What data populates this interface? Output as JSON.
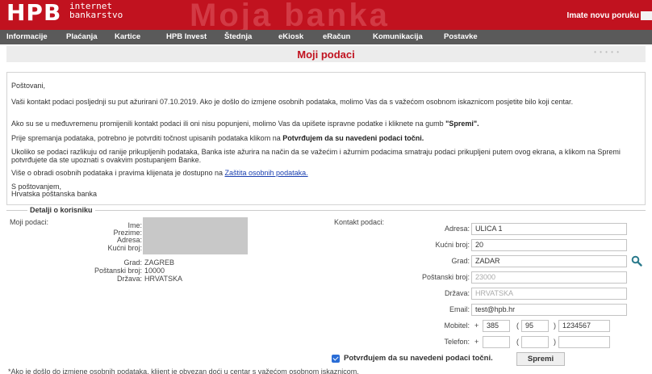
{
  "header": {
    "logo": "HPB",
    "logo_sub_1": "internet",
    "logo_sub_2": "bankarstvo",
    "watermark": "Moja banka",
    "new_message": "Imate novu poruku"
  },
  "nav": {
    "items": [
      "Informacije",
      "Plaćanja",
      "Kartice",
      "HPB Invest",
      "Štednja",
      "eKiosk",
      "eRačun",
      "Komunikacija",
      "Postavke"
    ]
  },
  "page": {
    "title": "Moji podaci",
    "dots": "• • • • •"
  },
  "intro": {
    "greeting": "Poštovani,",
    "p1": "Vaši kontakt podaci posljednji su put ažurirani 07.10.2019. Ako je došlo do izmjene osobnih podataka, molimo Vas da s važećom osobnom iskaznicom posjetite bilo koji centar.",
    "p2_before": "Ako su se u međuvremenu promijenili kontakt podaci ili oni nisu popunjeni, molimo Vas da upišete ispravne podatke i kliknete na gumb ",
    "p2_bold": "\"Spremi\".",
    "p3_before": "Prije spremanja podataka, potrebno je potvrditi točnost upisanih podataka klikom na ",
    "p3_bold": "Potvrđujem da su navedeni podaci točni.",
    "p4": "Ukoliko se podaci razlikuju od ranije prikupljenih podataka, Banka iste ažurira na način da se važećim i ažurnim podacima smatraju podaci prikupljeni putem ovog ekrana, a klikom na Spremi potvrđujete da ste upoznati s ovakvim postupanjem Banke.",
    "p5_before": "Više o obradi osobnih podataka i pravima klijenata je dostupno na ",
    "p5_link": "Zaštita osobnih podataka.",
    "sign_1": "S poštovanjem,",
    "sign_2": "Hrvatska poštanska banka"
  },
  "details": {
    "legend": "Detalji o korisniku",
    "moji_podaci_label": "Moji podaci:",
    "labels": {
      "ime": "Ime:",
      "prezime": "Prezime:",
      "adresa": "Adresa:",
      "kucni_broj": "Kućni broj:",
      "grad": "Grad:",
      "postanski_broj": "Poštanski broj:",
      "drzava": "Država:"
    },
    "values": {
      "grad": "ZAGREB",
      "postanski_broj": "10000",
      "drzava": "HRVATSKA"
    }
  },
  "contact": {
    "label": "Kontakt podaci:",
    "adresa_label": "Adresa:",
    "adresa": "ULICA 1",
    "kucni_broj_label": "Kućni broj:",
    "kucni_broj": "20",
    "grad_label": "Grad:",
    "grad": "ZADAR",
    "postanski_broj_label": "Poštanski broj:",
    "postanski_broj": "23000",
    "drzava_label": "Država:",
    "drzava": "HRVATSKA",
    "email_label": "Email:",
    "email": "test@hpb.hr",
    "mobitel_label": "Mobitel:",
    "mobitel_plus": "+",
    "mobitel_country": "385",
    "paren_open": "(",
    "mobitel_area": "95",
    "paren_close": ")",
    "mobitel_number": "1234567",
    "telefon_label": "Telefon:",
    "telefon_plus": "+",
    "telefon_country": "",
    "telefon_area": "",
    "telefon_number": ""
  },
  "actions": {
    "confirm": "Potvrđujem da su navedeni podaci točni.",
    "save": "Spremi"
  },
  "footnote": "*Ako je došlo do izmjene osobnih podataka, klijent je obvezan doći u centar s važećom osobnom iskaznicom.",
  "colors": {
    "brand_red": "#c1121f",
    "nav_grey": "#5a5a5a",
    "checkbox_blue": "#2a6dd6",
    "icon_teal": "#2a7a8c"
  }
}
